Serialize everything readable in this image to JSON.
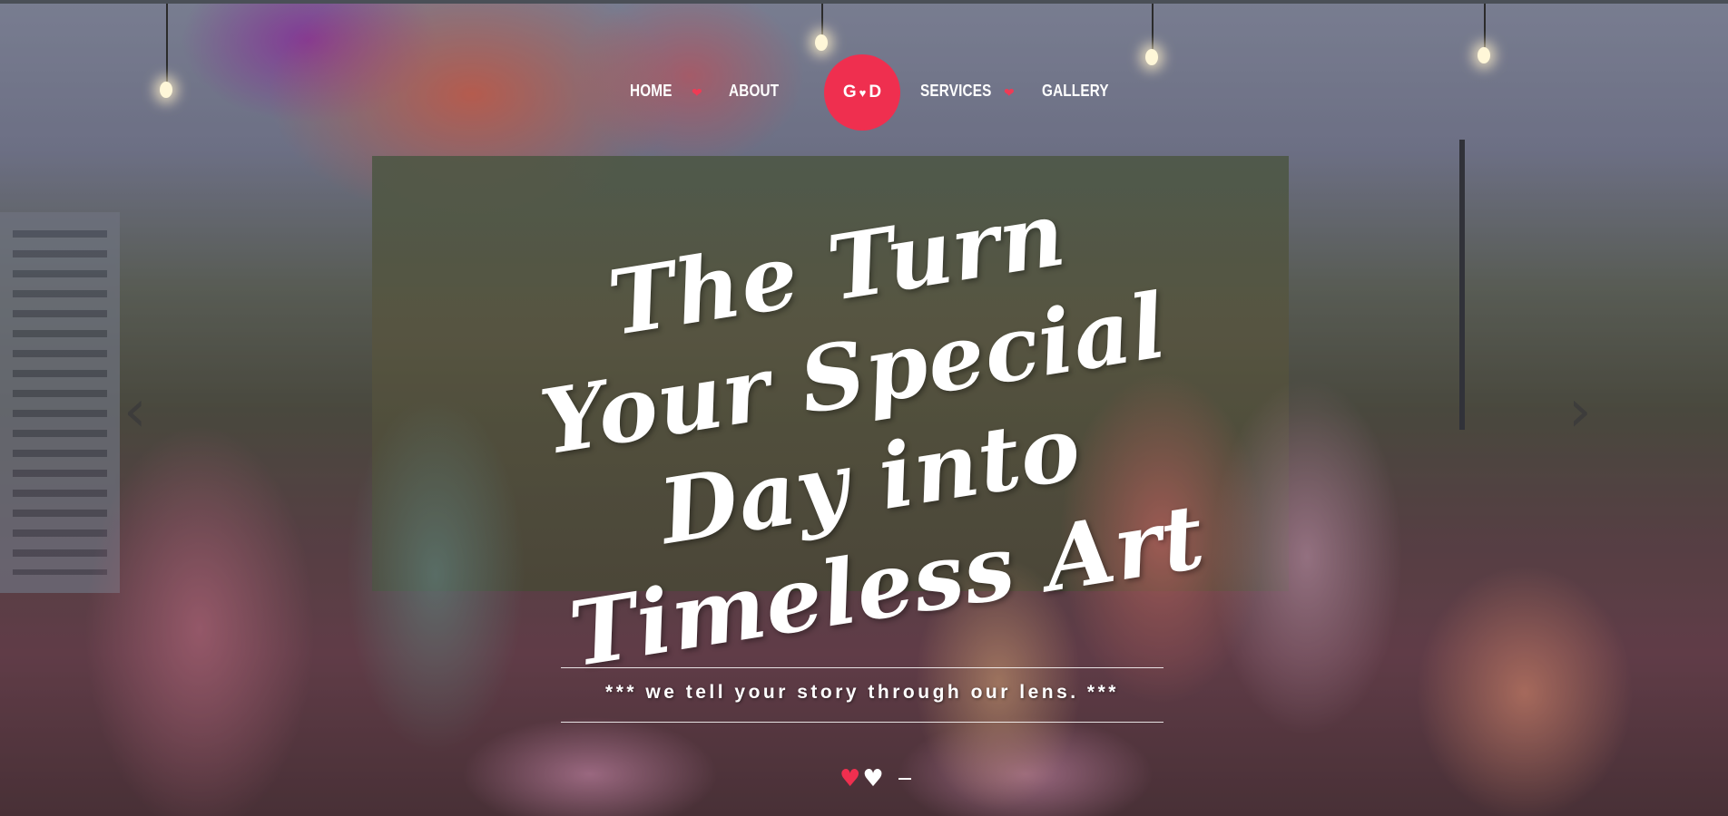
{
  "nav": {
    "home_label": "HOME",
    "about_label": "ABOUT",
    "services_label": "SERVICES",
    "gallery_label": "GALLERY",
    "separator_icon": "heart-icon",
    "logo": {
      "left": "G",
      "heart": "♥",
      "right": "D"
    }
  },
  "hero": {
    "headline": "The Turn Your Special Day into Timeless Art",
    "tagline": "*** we tell your story through our lens. ***",
    "prev_arrow": "‹",
    "next_arrow": "›",
    "indicators": [
      "♥",
      "♥"
    ],
    "active_indicator": 0
  },
  "colors": {
    "accent": "#ef2f4f",
    "text": "#ffffff"
  }
}
